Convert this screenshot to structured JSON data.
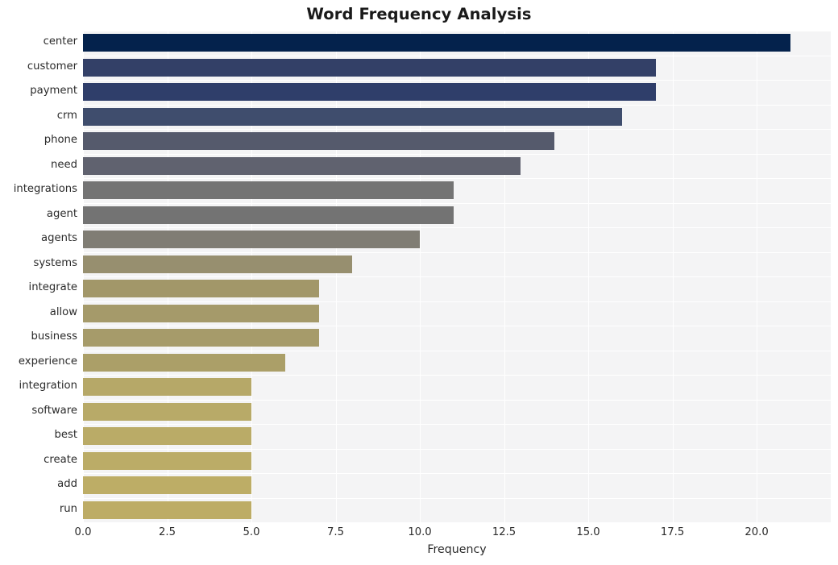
{
  "chart_data": {
    "type": "bar",
    "orientation": "horizontal",
    "title": "Word Frequency Analysis",
    "xlabel": "Frequency",
    "ylabel": "",
    "categories": [
      "center",
      "customer",
      "payment",
      "crm",
      "phone",
      "need",
      "integrations",
      "agent",
      "agents",
      "systems",
      "integrate",
      "allow",
      "business",
      "experience",
      "integration",
      "software",
      "best",
      "create",
      "add",
      "run"
    ],
    "values": [
      21,
      17,
      17,
      16,
      14,
      13,
      11,
      11,
      10,
      8,
      7,
      7,
      7,
      6,
      5,
      5,
      5,
      5,
      5,
      5
    ],
    "bar_colors": [
      "#04224c",
      "#334067",
      "#2f3e6a",
      "#3f4d6d",
      "#555a6c",
      "#60626f",
      "#747474",
      "#737373",
      "#807d74",
      "#978f6f",
      "#a29769",
      "#a59a6a",
      "#a69b6a",
      "#ab9f68",
      "#b6a868",
      "#b8aa68",
      "#baab67",
      "#bbac67",
      "#bdad66",
      "#bdac66"
    ],
    "xlim": [
      0,
      22.2
    ],
    "xticks": [
      0.0,
      2.5,
      5.0,
      7.5,
      10.0,
      12.5,
      15.0,
      17.5,
      20.0
    ],
    "xtick_labels": [
      "0.0",
      "2.5",
      "5.0",
      "7.5",
      "10.0",
      "12.5",
      "15.0",
      "17.5",
      "20.0"
    ],
    "grid": true,
    "grid_color": "#ffffff",
    "plot_background": "#f4f4f5",
    "figure_background": "#ffffff",
    "legend": null
  },
  "figure": {
    "title": "Word Frequency Analysis"
  }
}
